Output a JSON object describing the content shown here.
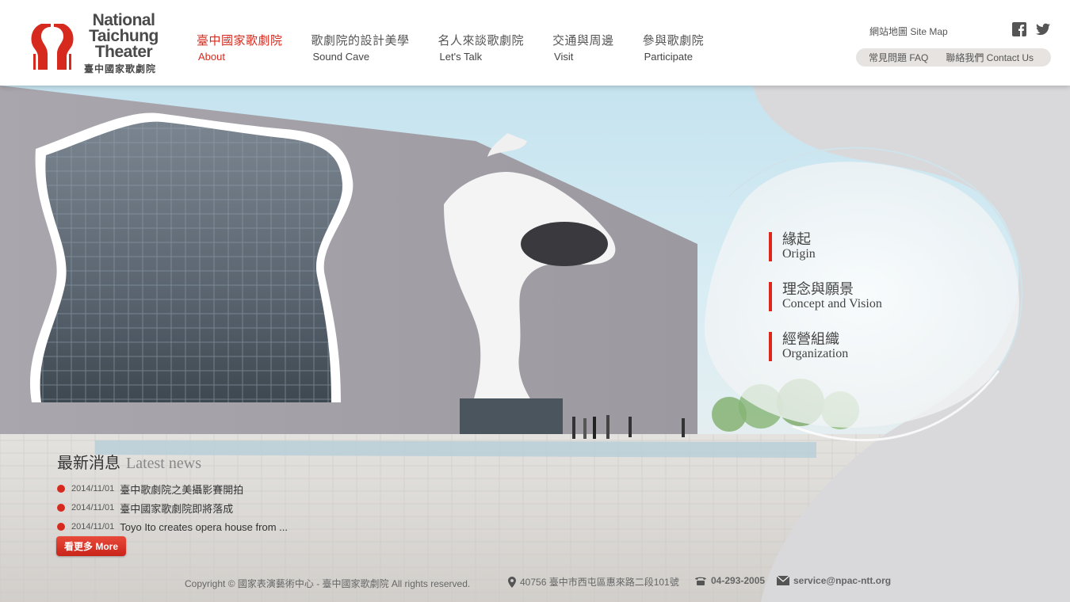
{
  "logo": {
    "line1": "National",
    "line2": "Taichung",
    "line3": "Theater",
    "zh": "臺中國家歌劇院"
  },
  "nav": [
    {
      "zh": "臺中國家歌劇院",
      "en": "About"
    },
    {
      "zh": "歌劇院的設計美學",
      "en": "Sound Cave"
    },
    {
      "zh": "名人來談歌劇院",
      "en": "Let's Talk"
    },
    {
      "zh": "交通與周邊",
      "en": "Visit"
    },
    {
      "zh": "參與歌劇院",
      "en": "Participate"
    }
  ],
  "utility": {
    "sitemap": "網站地圖 Site Map",
    "faq": "常見問題 FAQ",
    "contact": "聯絡我們 Contact Us"
  },
  "social": {
    "facebook_icon": "facebook-icon",
    "twitter_icon": "twitter-icon"
  },
  "side_menu": [
    {
      "zh": "緣起",
      "en": "Origin"
    },
    {
      "zh": "理念與願景",
      "en": "Concept and Vision"
    },
    {
      "zh": "經營組織",
      "en": "Organization"
    }
  ],
  "news": {
    "title_zh": "最新消息",
    "title_en": "Latest news",
    "items": [
      {
        "date": "2014/11/01",
        "text": "臺中歌劇院之美攝影賽開拍"
      },
      {
        "date": "2014/11/01",
        "text": "臺中國家歌劇院即將落成"
      },
      {
        "date": "2014/11/01",
        "text": "Toyo Ito creates opera house from ..."
      }
    ],
    "more": "看更多  More"
  },
  "footer": {
    "copyright": "Copyright © 國家表演藝術中心 - 臺中國家歌劇院 All rights reserved.",
    "address": "40756 臺中市西屯區惠來路二段101號",
    "phone": "04-293-2005",
    "email": "service@npac-ntt.org"
  },
  "colors": {
    "accent": "#d72a1e",
    "text": "#444444",
    "pill": "#e6e3e0"
  }
}
